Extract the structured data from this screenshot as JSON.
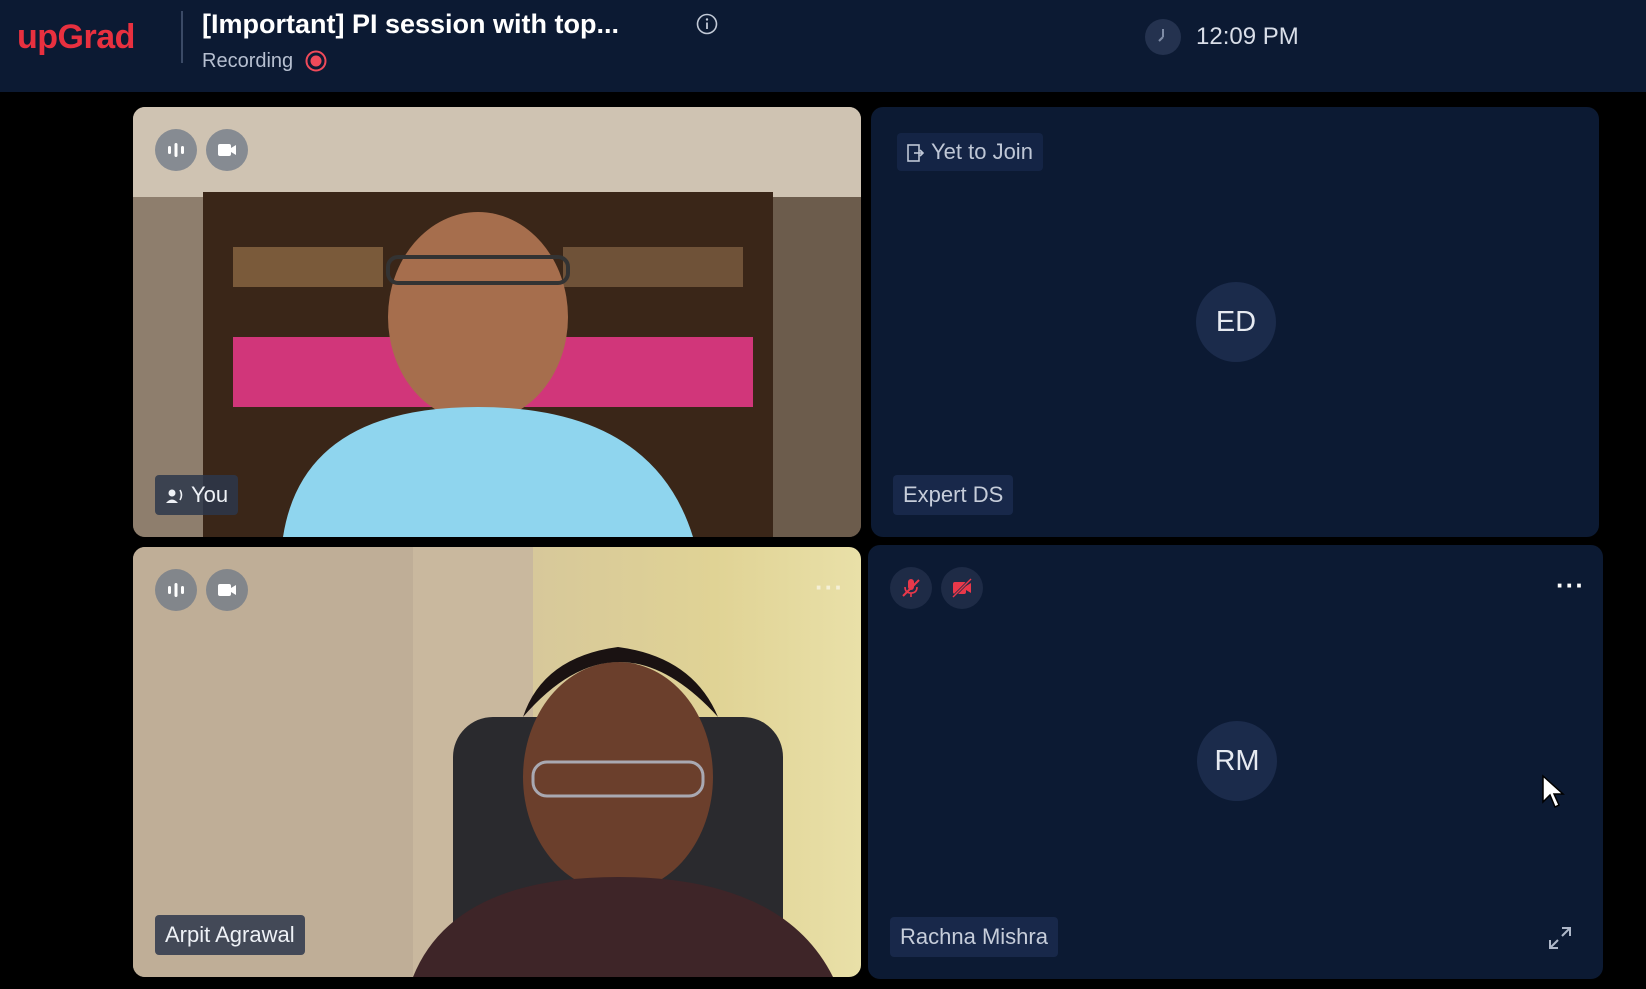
{
  "header": {
    "logo": "upGrad",
    "title": "[Important] PI session with top...",
    "recording_label": "Recording",
    "time": "12:09 PM"
  },
  "tiles": [
    {
      "name": "You",
      "type": "video",
      "mic_on": true,
      "camera_on": true,
      "speaking": true
    },
    {
      "name": "Expert DS",
      "type": "avatar",
      "initials": "ED",
      "status": "Yet to Join"
    },
    {
      "name": "Arpit Agrawal",
      "type": "video",
      "mic_on": true,
      "camera_on": true,
      "more_icon": "more-horizontal-icon"
    },
    {
      "name": "Rachna Mishra",
      "type": "avatar",
      "initials": "RM",
      "mic_on": false,
      "camera_on": false,
      "more_icon": "more-horizontal-icon",
      "expand_icon": "expand-icon"
    }
  ],
  "colors": {
    "brand": "#e8303f",
    "header_bg": "#0c1a33",
    "tile_bg": "#0c1a33",
    "muted_red": "#e8384a",
    "recording_red": "#f04a5a"
  }
}
